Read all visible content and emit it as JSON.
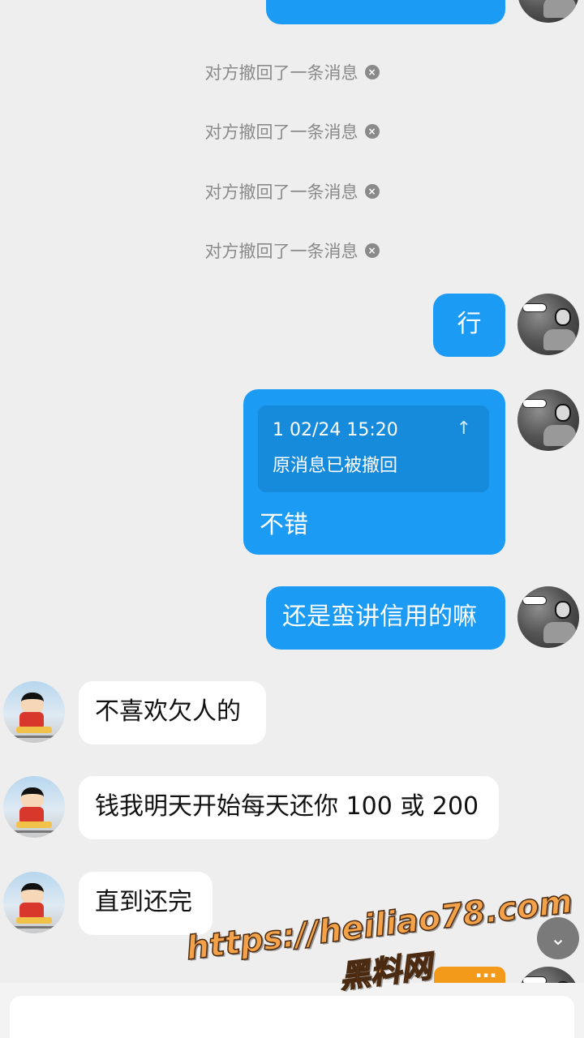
{
  "recalled_notices": [
    "对方撤回了一条消息",
    "对方撤回了一条消息",
    "对方撤回了一条消息",
    "对方撤回了一条消息"
  ],
  "recalled_close_glyph": "×",
  "messages": {
    "m1": "行",
    "m2": {
      "quote_time": "1 02/24 15:20",
      "quote_text": "原消息已被撤回",
      "quote_icon": "↑",
      "text": "不错"
    },
    "m3": "还是蛮讲信用的嘛",
    "m4": "不喜欢欠人的",
    "m5": "钱我明天开始每天还你 100 或 200",
    "m6": "直到还完"
  },
  "scroll_down_glyph": "⌄",
  "watermark": {
    "url": "https://heiliao78.com",
    "name": "黑料网"
  },
  "colors": {
    "outgoing_bubble": "#1b9bf3",
    "incoming_bubble": "#ffffff",
    "background": "#eeeeee",
    "watermark": "#f4a24a"
  }
}
